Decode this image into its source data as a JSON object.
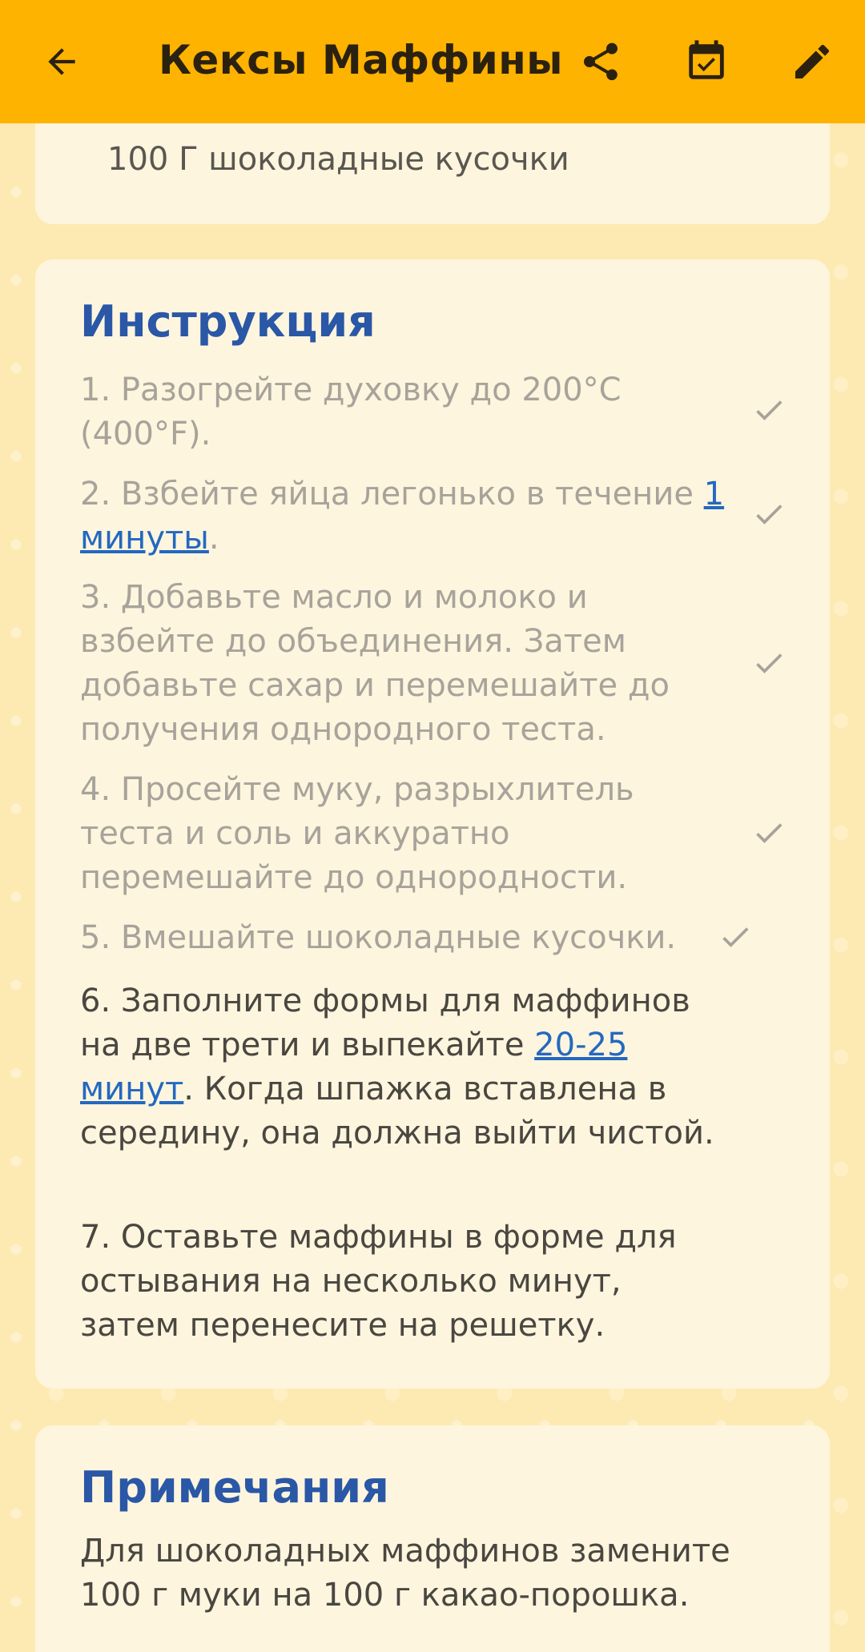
{
  "appbar": {
    "title": "Кексы Маффины",
    "back_icon": "arrow-left-icon",
    "share_icon": "share-icon",
    "calendar_icon": "calendar-check-icon",
    "edit_icon": "pencil-icon"
  },
  "ingredients": {
    "last_item": "100 Г шоколадные кусочки"
  },
  "instructions": {
    "title": "Инструкция",
    "steps": [
      {
        "pre": "1. Разогрейте духовку до 200°C (400°F).",
        "done": true
      },
      {
        "pre": "2. Взбейте яйца легонько в течение ",
        "link": "1 минуты",
        "post": ".",
        "done": true
      },
      {
        "pre": "3. Добавьте масло и молоко и взбейте до объединения. Затем добавьте сахар и перемешайте до получения однородного теста.",
        "done": true
      },
      {
        "pre": "4. Просейте муку, разрыхлитель теста и соль и аккуратно перемешайте до однородности.",
        "done": true
      },
      {
        "pre": "5. Вмешайте шоколадные кусочки.",
        "done": true
      },
      {
        "pre": "6. Заполните формы для маффинов на две трети и выпекайте ",
        "link": "20-25 минут",
        "post": ". Когда шпажка вставлена в середину, она должна выйти чистой.",
        "done": false
      },
      {
        "pre": "7. Оставьте маффины в форме для остывания на несколько минут, затем перенесите на решетку.",
        "done": false
      }
    ]
  },
  "notes": {
    "title": "Примечания",
    "text": "Для шоколадных маффинов замените 100 г муки на 100 г какао-порошка."
  },
  "colors": {
    "appbar": "#feb300",
    "accent_title": "#2a57a6",
    "link": "#2468c0",
    "done_text": "#a8a39a"
  }
}
